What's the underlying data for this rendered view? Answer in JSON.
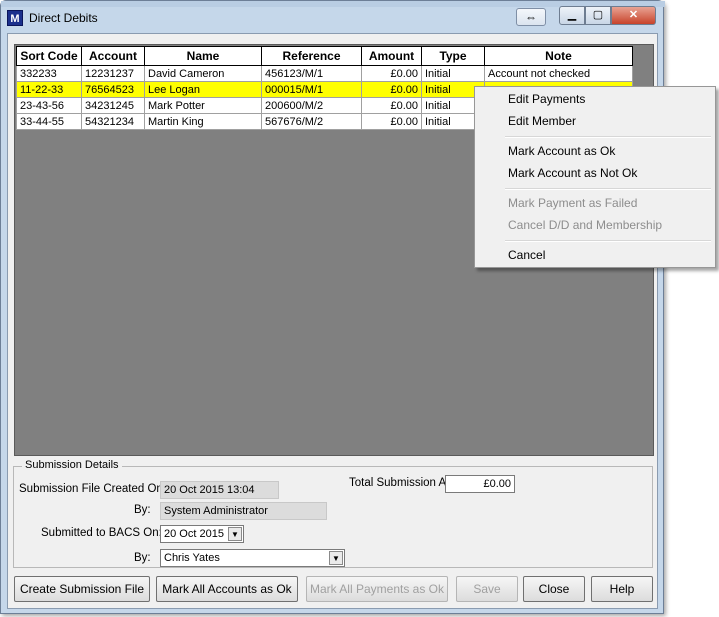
{
  "window": {
    "title": "Direct Debits",
    "app_icon_letter": "M",
    "swap_icon": "swap-arrows-icon",
    "min_icon": "minimize-icon",
    "max_icon": "maximize-icon",
    "close_glyph": "✕"
  },
  "grid": {
    "columns": [
      "Sort Code",
      "Account",
      "Name",
      "Reference",
      "Amount",
      "Type",
      "Note"
    ],
    "rows": [
      {
        "sort": "332233",
        "account": "12231237",
        "name": "David Cameron",
        "reference": "456123/M/1",
        "amount": "£0.00",
        "type": "Initial",
        "note": "Account not checked"
      },
      {
        "sort": "11-22-33",
        "account": "76564523",
        "name": "Lee Logan",
        "reference": "000015/M/1",
        "amount": "£0.00",
        "type": "Initial",
        "note": ""
      },
      {
        "sort": "23-43-56",
        "account": "34231245",
        "name": "Mark Potter",
        "reference": "200600/M/2",
        "amount": "£0.00",
        "type": "Initial",
        "note": ""
      },
      {
        "sort": "33-44-55",
        "account": "54321234",
        "name": "Martin King",
        "reference": "567676/M/2",
        "amount": "£0.00",
        "type": "Initial",
        "note": ""
      }
    ],
    "selected_row_color": "#ffff00"
  },
  "context_menu": {
    "items": [
      {
        "label": "Edit Payments",
        "enabled": true
      },
      {
        "label": "Edit Member",
        "enabled": true
      },
      {
        "label": "Mark Account as Ok",
        "enabled": true
      },
      {
        "label": "Mark Account as Not Ok",
        "enabled": true
      },
      {
        "label": "Mark Payment as Failed",
        "enabled": false
      },
      {
        "label": "Cancel D/D and Membership",
        "enabled": false
      },
      {
        "label": "Cancel",
        "enabled": true
      }
    ]
  },
  "submission": {
    "group_title": "Submission Details",
    "created_label": "Submission File Created On:",
    "created_value": "20 Oct 2015 13:04",
    "by_label": "By:",
    "by_value": "System Administrator",
    "total_label": "Total Submission Amount:",
    "total_value": "£0.00",
    "bacs_label": "Submitted to BACS On:",
    "bacs_value": "20 Oct  2015",
    "by2_label": "By:",
    "by2_value": "Chris Yates"
  },
  "buttons": {
    "create": "Create Submission File",
    "mark_all_accounts": "Mark All Accounts as Ok",
    "mark_all_payments": "Mark All Payments as Ok",
    "save": "Save",
    "close": "Close",
    "help": "Help"
  }
}
